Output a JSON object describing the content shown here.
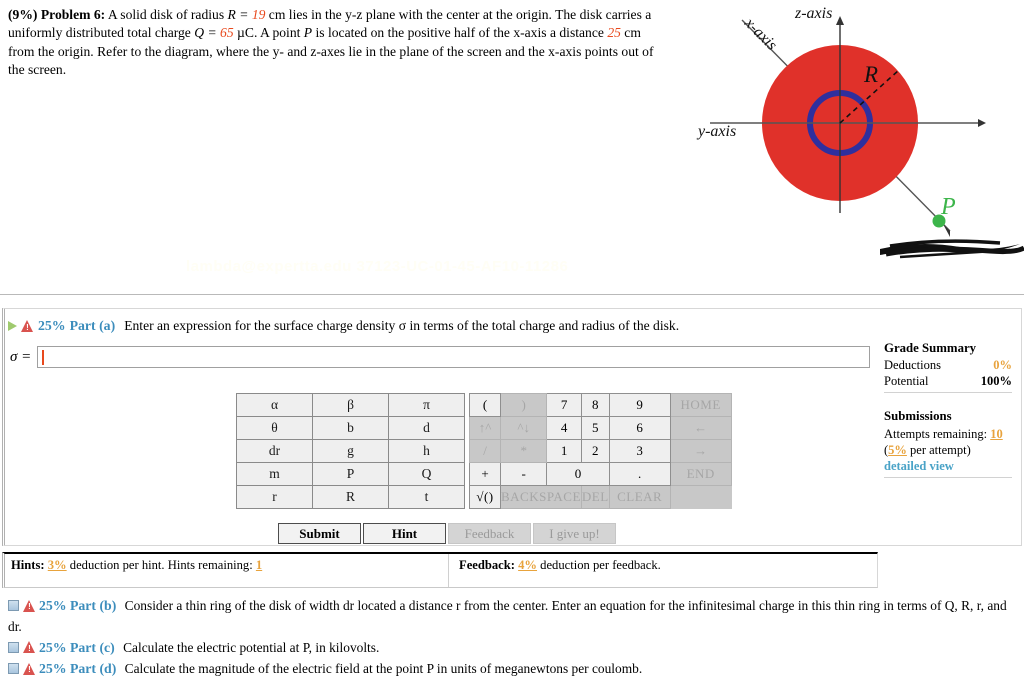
{
  "problem": {
    "percent": "(9%)",
    "label": "Problem 6:",
    "text_1": "A solid disk of radius ",
    "sym_R": "R = ",
    "val_R": "19",
    "text_2": " cm lies in the y-z plane with the center at the origin. The disk carries a uniformly distributed total charge ",
    "sym_Q": "Q = ",
    "val_Q": "65",
    "text_3": " µC. A point ",
    "sym_P": "P",
    "text_4": " is located on the positive half of the x-axis a distance ",
    "val_d": "25",
    "text_5": " cm from the origin. Refer to the diagram, where the y- and z-axes lie in the plane of the screen and the x-axis points out of the screen."
  },
  "diagram": {
    "z_axis_label": "z-axis",
    "y_axis_label": "y-axis",
    "x_axis_label": "x-axis",
    "radius_label": "R",
    "point_label": "P",
    "disk_color": "#e0312a",
    "ring_color": "#2f2f9e",
    "point_color": "#3cb54a"
  },
  "part_a": {
    "percent": "25%",
    "title": "Part (a)",
    "text": "Enter an expression for the surface charge density σ in terms of the total charge and radius of the disk.",
    "answer_label": "σ =",
    "answer_value": "",
    "answer_placeholder": ""
  },
  "keypad": {
    "symbols": [
      [
        "α",
        "β",
        "π"
      ],
      [
        "θ",
        "b",
        "d"
      ],
      [
        "dr",
        "g",
        "h"
      ],
      [
        "m",
        "P",
        "Q"
      ],
      [
        "r",
        "R",
        "t"
      ]
    ],
    "numeric": [
      [
        {
          "label": "(",
          "enabled": true
        },
        {
          "label": ")",
          "enabled": false
        },
        {
          "label": "7",
          "enabled": true
        },
        {
          "label": "8",
          "enabled": true
        },
        {
          "label": "9",
          "enabled": true
        },
        {
          "label": "HOME",
          "enabled": false
        }
      ],
      [
        {
          "label": "↑^",
          "enabled": false
        },
        {
          "label": "^↓",
          "enabled": false
        },
        {
          "label": "4",
          "enabled": true
        },
        {
          "label": "5",
          "enabled": true
        },
        {
          "label": "6",
          "enabled": true
        },
        {
          "label": "←",
          "enabled": false
        }
      ],
      [
        {
          "label": "/",
          "enabled": false
        },
        {
          "label": "*",
          "enabled": false
        },
        {
          "label": "1",
          "enabled": true
        },
        {
          "label": "2",
          "enabled": true
        },
        {
          "label": "3",
          "enabled": true
        },
        {
          "label": "→",
          "enabled": false
        }
      ],
      [
        {
          "label": "+",
          "enabled": true
        },
        {
          "label": "-",
          "enabled": true
        },
        {
          "label": "0",
          "enabled": true
        },
        {
          "label": ".",
          "enabled": true
        },
        {
          "label": "END",
          "enabled": false
        }
      ],
      [
        {
          "label": "√()",
          "enabled": true
        },
        {
          "label": "BACKSPACE",
          "enabled": false
        },
        {
          "label": "DEL",
          "enabled": false
        },
        {
          "label": "CLEAR",
          "enabled": false
        }
      ]
    ]
  },
  "buttons": {
    "submit": "Submit",
    "hint": "Hint",
    "feedback": "Feedback",
    "give_up": "I give up!"
  },
  "grade_summary": {
    "heading": "Grade Summary",
    "deductions_label": "Deductions",
    "deductions_value": "0%",
    "potential_label": "Potential",
    "potential_value": "100%",
    "submissions_heading": "Submissions",
    "attempts_label": "Attempts remaining:",
    "attempts_value": "10",
    "per_attempt_open": "(",
    "per_attempt_value": "5%",
    "per_attempt_close": " per attempt)",
    "detailed_view": "detailed view"
  },
  "hints_feedback": {
    "hints_label": "Hints:",
    "hints_pct": "3%",
    "hints_text_1": "deduction per hint. Hints remaining:",
    "hints_remaining": "1",
    "feedback_label": "Feedback:",
    "feedback_pct": "4%",
    "feedback_text": "deduction per feedback."
  },
  "other_parts": [
    {
      "percent": "25%",
      "title": "Part (b)",
      "text": "Consider a thin ring of the disk of width dr located a distance r from the center. Enter an equation for the infinitesimal charge in this thin ring in terms of Q, R, r, and dr."
    },
    {
      "percent": "25%",
      "title": "Part (c)",
      "text": "Calculate the electric potential at P, in kilovolts."
    },
    {
      "percent": "25%",
      "title": "Part (d)",
      "text": "Calculate the magnitude of the electric field at the point P in units of meganewtons per coulomb."
    }
  ],
  "watermark": {
    "line_1": "lambda@expertta.edu 37123-UC-01-45-AF10-11286",
    "line_2": "lambda@expertta.edu 37123-UC-01-45-AF10-11286"
  }
}
